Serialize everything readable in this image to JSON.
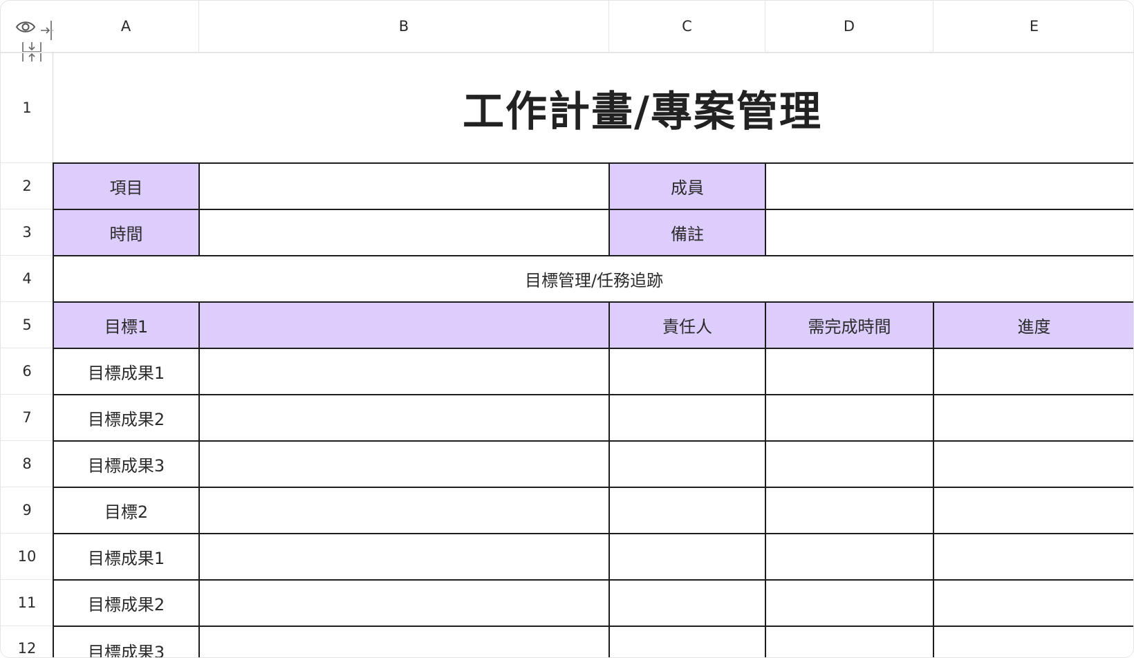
{
  "columns": [
    "A",
    "B",
    "C",
    "D",
    "E"
  ],
  "rows": [
    "1",
    "2",
    "3",
    "4",
    "5",
    "6",
    "7",
    "8",
    "9",
    "10",
    "11",
    "12"
  ],
  "icons": [
    "eye-icon",
    "collapse-columns-icon",
    "collapse-rows-icon"
  ],
  "title": "工作計畫/專案管理",
  "info": {
    "project_label": "項目",
    "member_label": "成員",
    "time_label": "時間",
    "note_label": "備註"
  },
  "section_title": "目標管理/任務追跡",
  "table_header": {
    "goal": "目標1",
    "owner": "責任人",
    "due": "需完成時間",
    "progress": "進度"
  },
  "task_rows": [
    "目標成果1",
    "目標成果2",
    "目標成果3",
    "目標2",
    "目標成果1",
    "目標成果2",
    "目標成果3"
  ],
  "colors": {
    "header_fill": "#dccdfd",
    "border": "#1c1c1c",
    "grid_light": "#e6e6e6"
  }
}
